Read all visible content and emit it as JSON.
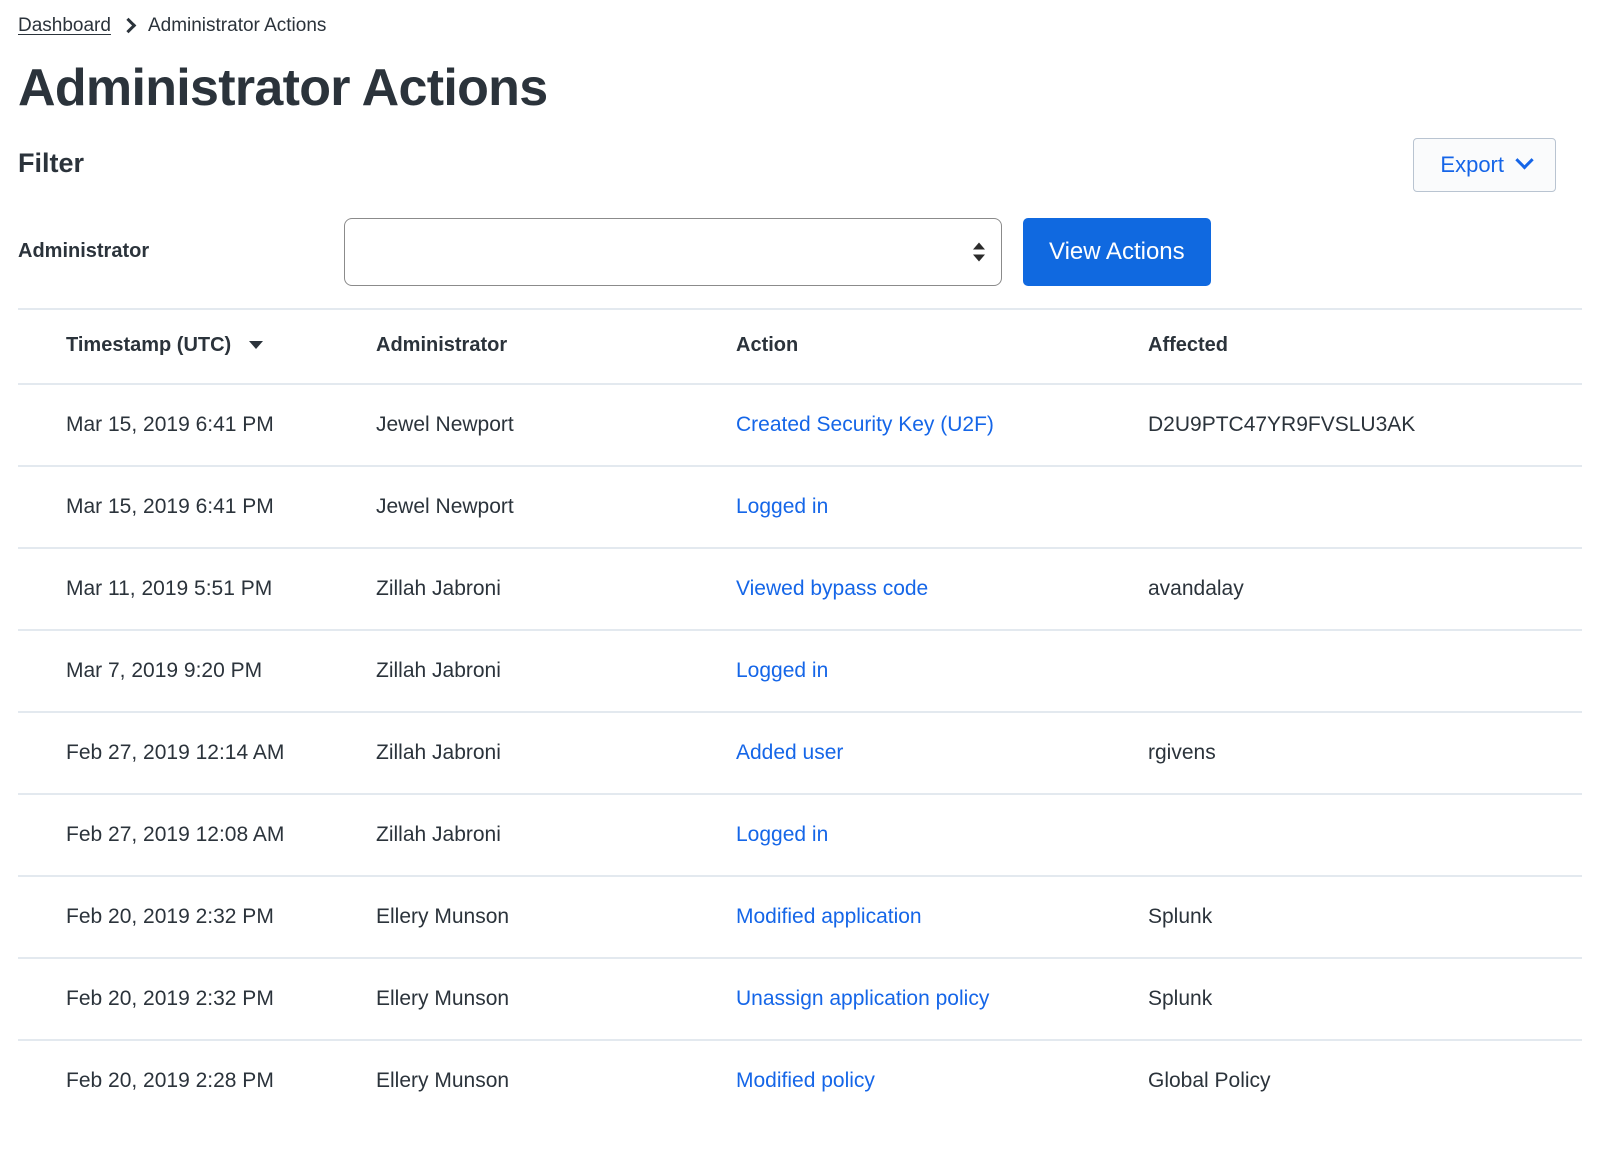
{
  "breadcrumb": {
    "parent": "Dashboard",
    "separator_icon": "chevron-right-icon",
    "current": "Administrator Actions"
  },
  "page_title": "Administrator Actions",
  "filter": {
    "legend": "Filter",
    "administrator_label": "Administrator",
    "administrator_value": "",
    "administrator_placeholder": "",
    "view_actions_label": "View Actions",
    "stepper_icon": "stepper-updown-icon"
  },
  "export": {
    "label": "Export",
    "icon": "chevron-down-icon"
  },
  "table": {
    "columns": [
      {
        "key": "timestamp",
        "label": "Timestamp (UTC)",
        "sorted": true,
        "sort_icon": "caret-down-icon"
      },
      {
        "key": "administrator",
        "label": "Administrator",
        "sorted": false
      },
      {
        "key": "action",
        "label": "Action",
        "sorted": false
      },
      {
        "key": "affected",
        "label": "Affected",
        "sorted": false
      }
    ],
    "rows": [
      {
        "timestamp": "Mar 15, 2019 6:41 PM",
        "administrator": "Jewel Newport",
        "action": "Created Security Key (U2F)",
        "affected": "D2U9PTC47YR9FVSLU3AK"
      },
      {
        "timestamp": "Mar 15, 2019 6:41 PM",
        "administrator": "Jewel Newport",
        "action": "Logged in",
        "affected": ""
      },
      {
        "timestamp": "Mar 11, 2019 5:51 PM",
        "administrator": "Zillah Jabroni",
        "action": "Viewed bypass code",
        "affected": "avandalay"
      },
      {
        "timestamp": "Mar 7, 2019 9:20 PM",
        "administrator": "Zillah Jabroni",
        "action": "Logged in",
        "affected": ""
      },
      {
        "timestamp": "Feb 27, 2019 12:14 AM",
        "administrator": "Zillah Jabroni",
        "action": "Added user",
        "affected": "rgivens"
      },
      {
        "timestamp": "Feb 27, 2019 12:08 AM",
        "administrator": "Zillah Jabroni",
        "action": "Logged in",
        "affected": ""
      },
      {
        "timestamp": "Feb 20, 2019 2:32 PM",
        "administrator": "Ellery Munson",
        "action": "Modified application",
        "affected": "Splunk"
      },
      {
        "timestamp": "Feb 20, 2019 2:32 PM",
        "administrator": "Ellery Munson",
        "action": "Unassign application policy",
        "affected": "Splunk"
      },
      {
        "timestamp": "Feb 20, 2019 2:28 PM",
        "administrator": "Ellery Munson",
        "action": "Modified policy",
        "affected": "Global Policy"
      }
    ]
  },
  "colors": {
    "link_blue": "#1566e8",
    "primary_button": "#1069e0",
    "text": "#2b333b",
    "divider": "#e3e9ef",
    "export_border": "#b9c4d1"
  }
}
